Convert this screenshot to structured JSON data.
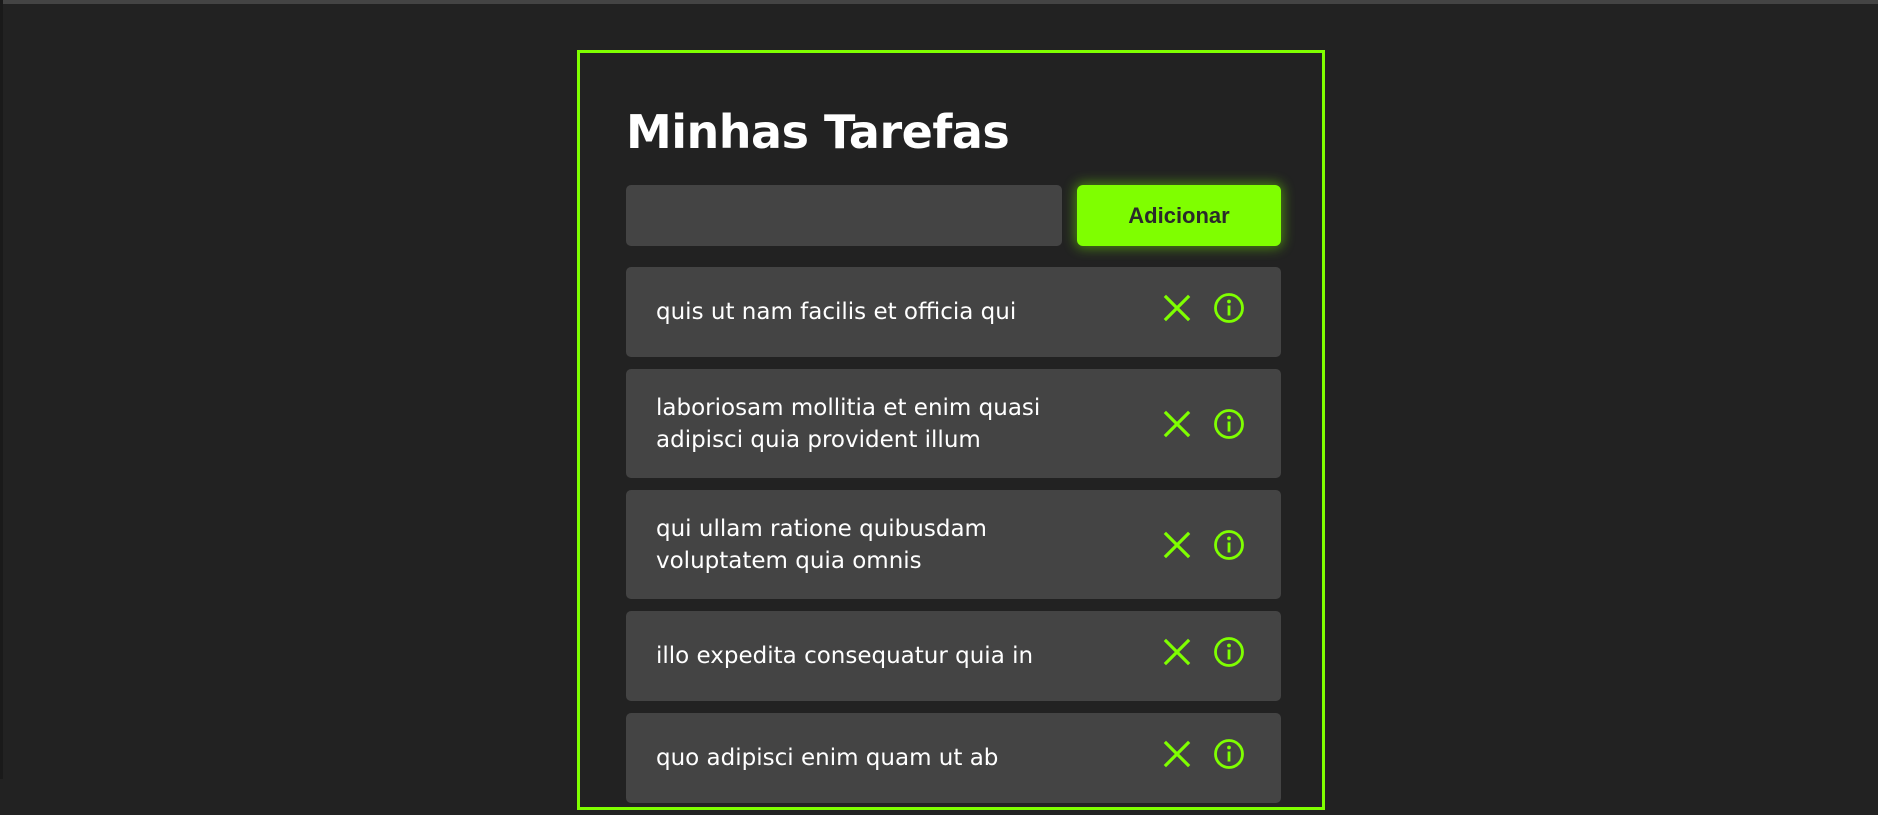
{
  "app": {
    "title": "Minhas Tarefas"
  },
  "form": {
    "input_value": "",
    "input_placeholder": "",
    "add_label": "Adicionar"
  },
  "tasks": [
    {
      "text": "quis ut nam facilis et officia qui"
    },
    {
      "text": "laboriosam mollitia et enim quasi adipisci quia provident illum"
    },
    {
      "text": "qui ullam ratione quibusdam voluptatem quia omnis"
    },
    {
      "text": "illo expedita consequatur quia in"
    },
    {
      "text": "quo adipisci enim quam ut ab"
    }
  ],
  "icons": {
    "delete": "close-icon",
    "details": "info-icon"
  },
  "colors": {
    "accent": "#7fff00",
    "background": "#222222",
    "card": "#444444",
    "text": "#ffffff"
  }
}
